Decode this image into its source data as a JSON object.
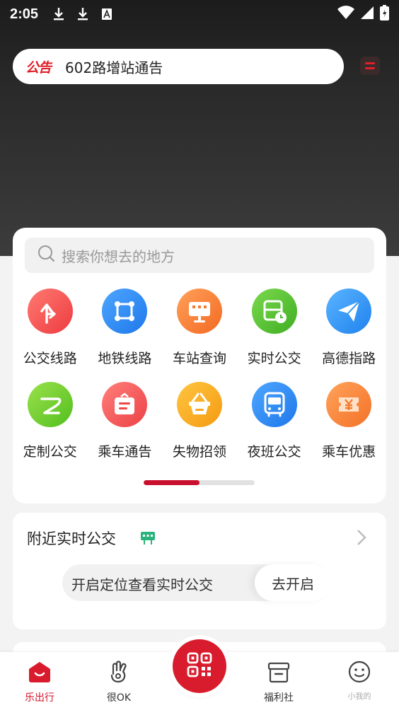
{
  "status_bar": {
    "time": "2:05",
    "icons": [
      "download-icon",
      "download-icon",
      "font-icon",
      "wifi-icon",
      "signal-icon",
      "battery-icon"
    ]
  },
  "notice": {
    "tag": "公告",
    "text": "602路增站通告"
  },
  "search": {
    "placeholder": "搜索你想去的地方"
  },
  "grid": {
    "row1": [
      {
        "label": "公交线路",
        "icon": "route-arrow-icon",
        "color": "#f0494c"
      },
      {
        "label": "地铁线路",
        "icon": "metro-icon",
        "color": "#2f8ef5"
      },
      {
        "label": "车站查询",
        "icon": "station-sign-icon",
        "color": "#f77d33"
      },
      {
        "label": "实时公交",
        "icon": "realtime-bus-icon",
        "color": "#57c236"
      },
      {
        "label": "高德指路",
        "icon": "paper-plane-icon",
        "color": "#3397f3"
      }
    ],
    "row2": [
      {
        "label": "定制公交",
        "icon": "custom-bus-icon",
        "color": "#6fcf30"
      },
      {
        "label": "乘车通告",
        "icon": "notice-board-icon",
        "color": "#f2585a"
      },
      {
        "label": "失物招领",
        "icon": "basket-icon",
        "color": "#f9a823"
      },
      {
        "label": "夜班公交",
        "icon": "night-bus-icon",
        "color": "#2f8ef5"
      },
      {
        "label": "乘车优惠",
        "icon": "coupon-icon",
        "color": "#f78535"
      }
    ]
  },
  "pager": {
    "progress": 0.5
  },
  "nearby": {
    "title": "附近实时公交",
    "locate_prompt": "开启定位查看实时公交",
    "locate_button": "去开启"
  },
  "tabbar": {
    "items": [
      {
        "label": "乐出行",
        "active": true
      },
      {
        "label": "很OK"
      },
      {
        "label": "福利社"
      },
      {
        "label": "小我的"
      }
    ]
  },
  "colors": {
    "accent": "#d81c2d"
  }
}
